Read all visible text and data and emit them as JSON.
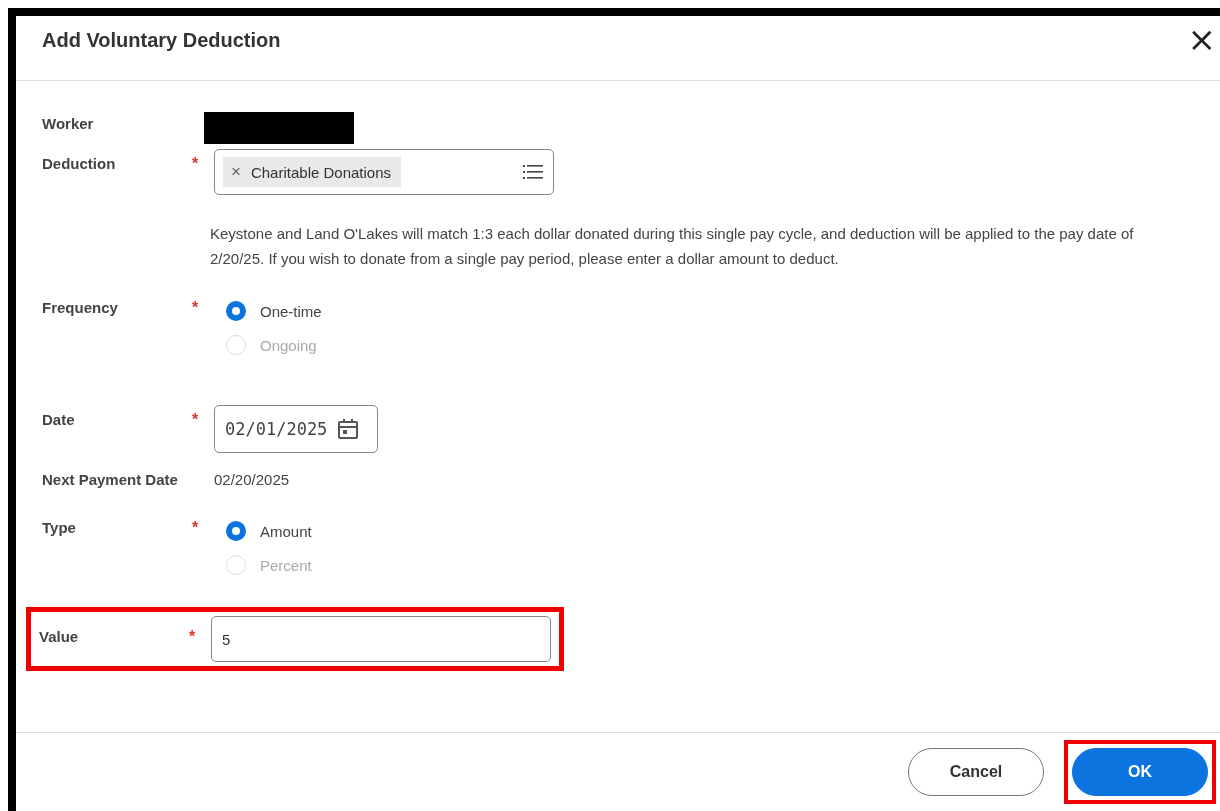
{
  "dialog": {
    "title": "Add Voluntary Deduction",
    "close": "×"
  },
  "fields": [
    {
      "kind": "redacted",
      "label": "Worker"
    },
    {
      "kind": "chip",
      "label": "Deduction",
      "required": true,
      "chip": "Charitable Donations",
      "chip_remove": "×",
      "note": "Keystone and Land O'Lakes will match 1:3 each dollar donated during this single pay cycle, and deduction will be applied to the pay date of 2/20/25. If you wish to donate from a single pay period, please enter a dollar amount to deduct."
    },
    {
      "kind": "radio",
      "label": "Frequency",
      "required": true,
      "options": [
        {
          "label": "One-time",
          "selected": true
        },
        {
          "label": "Ongoing",
          "selected": false
        }
      ]
    },
    {
      "kind": "date",
      "label": "Date",
      "required": true,
      "value": "02/01/2025"
    },
    {
      "kind": "text",
      "label": "Next Payment Date",
      "value": "02/20/2025"
    },
    {
      "kind": "radio",
      "label": "Type",
      "required": true,
      "options": [
        {
          "label": "Amount",
          "selected": true
        },
        {
          "label": "Percent",
          "selected": false
        }
      ]
    },
    {
      "kind": "input",
      "label": "Value",
      "required": true,
      "value": "5",
      "highlighted": true
    }
  ],
  "required_mark": "*",
  "buttons": [
    {
      "label": "Cancel",
      "primary": false,
      "highlighted": false
    },
    {
      "label": "OK",
      "primary": true,
      "highlighted": true
    }
  ]
}
